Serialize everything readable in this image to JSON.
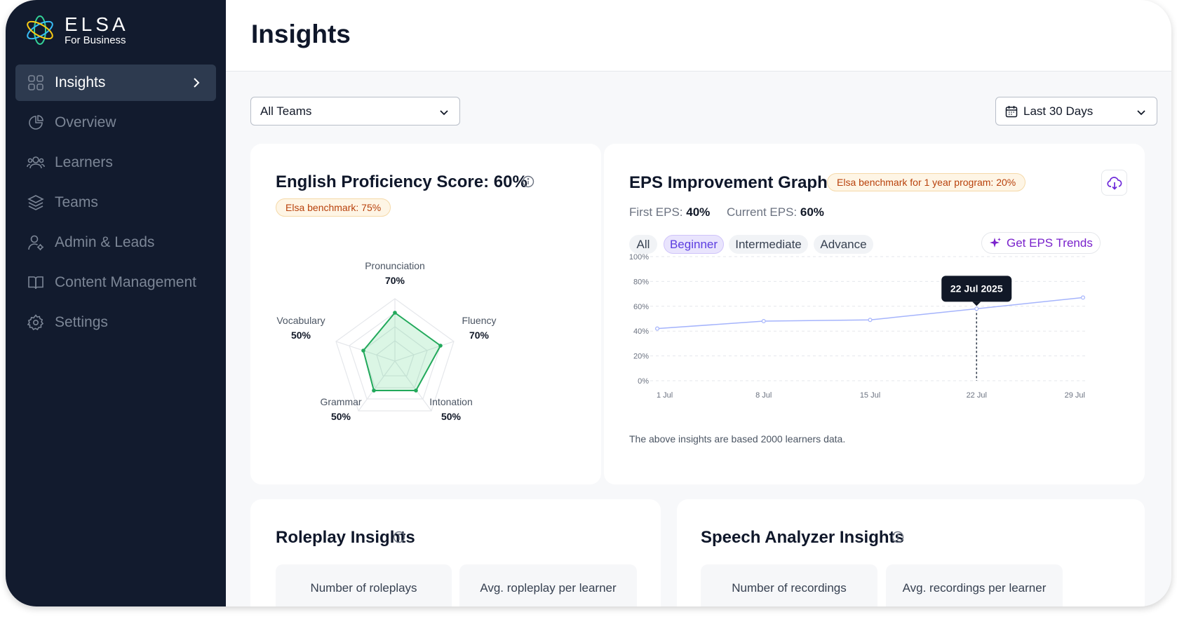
{
  "brand": {
    "name": "ELSA",
    "subtitle": "For Business"
  },
  "sidebar": {
    "items": [
      {
        "label": "Insights",
        "icon": "grid-icon",
        "active": true
      },
      {
        "label": "Overview",
        "icon": "pie-chart-icon"
      },
      {
        "label": "Learners",
        "icon": "users-icon"
      },
      {
        "label": "Teams",
        "icon": "layers-icon"
      },
      {
        "label": "Admin & Leads",
        "icon": "user-settings-icon"
      },
      {
        "label": "Content Management",
        "icon": "book-icon"
      },
      {
        "label": "Settings",
        "icon": "gear-icon"
      }
    ]
  },
  "header": {
    "title": "Insights"
  },
  "filters": {
    "team": "All Teams",
    "range": "Last 30 Days"
  },
  "eps_card": {
    "title": "English Proficiency Score: 60%",
    "benchmark": "Elsa benchmark: 75%",
    "skills": [
      {
        "name": "Pronunciation",
        "value": "70%"
      },
      {
        "name": "Fluency",
        "value": "70%"
      },
      {
        "name": "Intonation",
        "value": "50%"
      },
      {
        "name": "Grammar",
        "value": "50%"
      },
      {
        "name": "Vocabulary",
        "value": "50%"
      }
    ]
  },
  "graph_card": {
    "title": "EPS Improvement Graph",
    "benchmark": "Elsa benchmark for 1 year program: 20%",
    "first_label": "First EPS:",
    "first_value": "40%",
    "current_label": "Current EPS:",
    "current_value": "60%",
    "tabs": [
      "All",
      "Beginner",
      "Intermediate",
      "Advance"
    ],
    "active_tab": "Beginner",
    "trends_button": "Get EPS Trends",
    "tooltip": "22 Jul 2025",
    "footnote": "The above insights are based 2000 learners data."
  },
  "chart_data": {
    "type": "line",
    "x": [
      "1 Jul",
      "8 Jul",
      "15 Jul",
      "22 Jul",
      "29 Jul"
    ],
    "y_ticks": [
      "100%",
      "80%",
      "60%",
      "40%",
      "20%",
      "0%"
    ],
    "ylim": [
      0,
      100
    ],
    "grid": true,
    "series": [
      {
        "values": [
          42,
          48,
          49,
          58,
          67
        ]
      }
    ],
    "colors": {
      "line": "#a5b4fc",
      "grid": "#e5e7eb",
      "guide": "#374151"
    }
  },
  "roleplay_card": {
    "title": "Roleplay Insights",
    "stats": [
      "Number of roleplays",
      "Avg. ropleplay per learner"
    ]
  },
  "speech_card": {
    "title": "Speech Analyzer Insights",
    "stats": [
      "Number of recordings",
      "Avg. recordings per learner"
    ]
  }
}
